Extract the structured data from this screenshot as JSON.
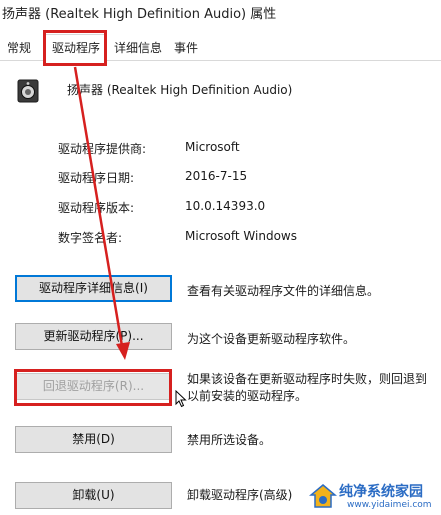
{
  "window": {
    "title": "扬声器 (Realtek High Definition Audio) 属性"
  },
  "tabs": [
    {
      "label": "常规"
    },
    {
      "label": "驱动程序"
    },
    {
      "label": "详细信息"
    },
    {
      "label": "事件"
    }
  ],
  "device": {
    "name": "扬声器 (Realtek High Definition Audio)",
    "icon": "speaker-icon"
  },
  "info": [
    {
      "label": "驱动程序提供商:",
      "value": "Microsoft"
    },
    {
      "label": "驱动程序日期:",
      "value": "2016-7-15"
    },
    {
      "label": "驱动程序版本:",
      "value": "10.0.14393.0"
    },
    {
      "label": "数字签名者:",
      "value": "Microsoft Windows"
    }
  ],
  "buttons": [
    {
      "label": "驱动程序详细信息(I)",
      "desc_lines": [
        "查看有关驱动程序文件的详细信息。"
      ]
    },
    {
      "label": "更新驱动程序(P)...",
      "desc_lines": [
        "为这个设备更新驱动程序软件。"
      ]
    },
    {
      "label": "回退驱动程序(R)...",
      "desc_lines": [
        "如果该设备在更新驱动程序时失败，则回退到",
        "以前安装的驱动程序。"
      ]
    },
    {
      "label": "禁用(D)",
      "desc_lines": [
        "禁用所选设备。"
      ]
    },
    {
      "label": "卸载(U)",
      "desc_lines": [
        "卸载驱动程序(高级)"
      ]
    }
  ],
  "watermark": {
    "title": "纯净系统家园",
    "url": "www.yidaimei.com"
  },
  "colors": {
    "highlight": "#d6201f",
    "focus": "#0078d7",
    "watermark": "#2b6cc4"
  }
}
